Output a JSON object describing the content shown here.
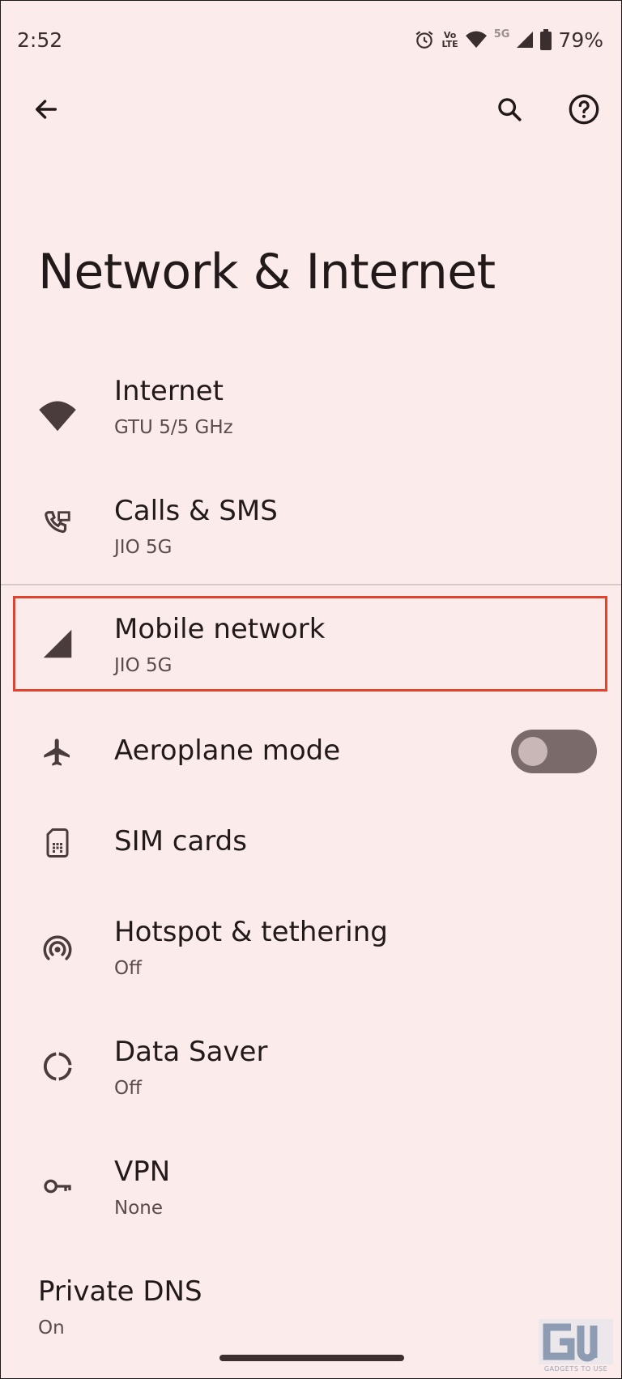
{
  "status_bar": {
    "time": "2:52",
    "volte_badge_top": "Vo",
    "volte_badge_bottom": "LTE",
    "network_badge": "5G",
    "battery": "79%",
    "icons": [
      "alarm-icon",
      "volte-icon",
      "wifi-icon",
      "cell-signal-icon",
      "battery-icon"
    ]
  },
  "toolbar": {
    "back_icon": "arrow-left-icon",
    "search_icon": "search-icon",
    "help_icon": "help-circle-icon"
  },
  "page": {
    "title": "Network & Internet"
  },
  "items": [
    {
      "id": "internet",
      "icon": "wifi-icon",
      "title": "Internet",
      "subtitle": "GTU 5/5 GHz"
    },
    {
      "id": "calls-sms",
      "icon": "calls-sms-icon",
      "title": "Calls & SMS",
      "subtitle": "JIO 5G"
    },
    {
      "id": "mobile-network",
      "icon": "cell-signal-icon",
      "title": "Mobile network",
      "subtitle": "JIO 5G",
      "highlighted": true
    },
    {
      "id": "aeroplane-mode",
      "icon": "airplane-icon",
      "title": "Aeroplane mode",
      "toggle_on": false
    },
    {
      "id": "sim-cards",
      "icon": "sim-card-icon",
      "title": "SIM cards"
    },
    {
      "id": "hotspot",
      "icon": "hotspot-icon",
      "title": "Hotspot & tethering",
      "subtitle": "Off"
    },
    {
      "id": "data-saver",
      "icon": "data-saver-icon",
      "title": "Data Saver",
      "subtitle": "Off"
    },
    {
      "id": "vpn",
      "icon": "key-icon",
      "title": "VPN",
      "subtitle": "None"
    },
    {
      "id": "private-dns",
      "title": "Private DNS",
      "subtitle": "On"
    }
  ],
  "watermark": {
    "logo": "G",
    "logo_accent": "U",
    "text": "GADGETS TO USE"
  },
  "colors": {
    "background": "#fcebeb",
    "text_primary": "#221a1a",
    "text_secondary": "#5a4c4c",
    "icon": "#4a3c3c",
    "highlight_border": "#e0442e",
    "toggle_track": "#7b6a6a",
    "toggle_knob": "#c9b6b6"
  }
}
